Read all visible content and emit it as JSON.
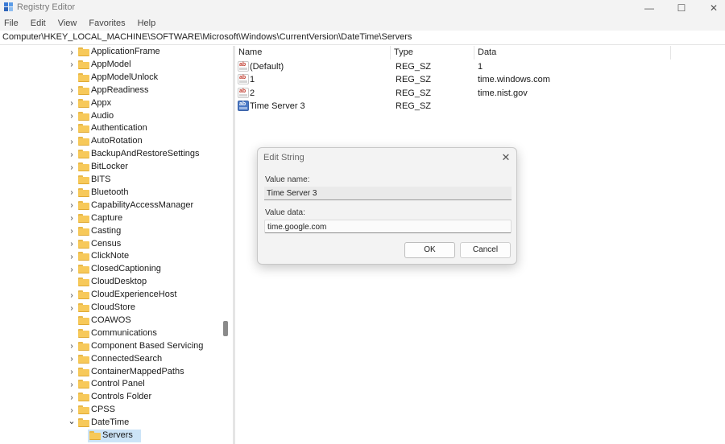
{
  "window": {
    "title": "Registry Editor",
    "minimize_glyph": "—",
    "maximize_glyph": "☐",
    "close_glyph": "✕"
  },
  "menu": [
    "File",
    "Edit",
    "View",
    "Favorites",
    "Help"
  ],
  "address": "Computer\\HKEY_LOCAL_MACHINE\\SOFTWARE\\Microsoft\\Windows\\CurrentVersion\\DateTime\\Servers",
  "tree": [
    {
      "label": "ApplicationFrame",
      "expandable": true
    },
    {
      "label": "AppModel",
      "expandable": true
    },
    {
      "label": "AppModelUnlock",
      "expandable": false
    },
    {
      "label": "AppReadiness",
      "expandable": true
    },
    {
      "label": "Appx",
      "expandable": true
    },
    {
      "label": "Audio",
      "expandable": true
    },
    {
      "label": "Authentication",
      "expandable": true
    },
    {
      "label": "AutoRotation",
      "expandable": true
    },
    {
      "label": "BackupAndRestoreSettings",
      "expandable": true
    },
    {
      "label": "BitLocker",
      "expandable": true
    },
    {
      "label": "BITS",
      "expandable": false
    },
    {
      "label": "Bluetooth",
      "expandable": true
    },
    {
      "label": "CapabilityAccessManager",
      "expandable": true
    },
    {
      "label": "Capture",
      "expandable": true
    },
    {
      "label": "Casting",
      "expandable": true
    },
    {
      "label": "Census",
      "expandable": true
    },
    {
      "label": "ClickNote",
      "expandable": true
    },
    {
      "label": "ClosedCaptioning",
      "expandable": true
    },
    {
      "label": "CloudDesktop",
      "expandable": false
    },
    {
      "label": "CloudExperienceHost",
      "expandable": true
    },
    {
      "label": "CloudStore",
      "expandable": true
    },
    {
      "label": "COAWOS",
      "expandable": false
    },
    {
      "label": "Communications",
      "expandable": false
    },
    {
      "label": "Component Based Servicing",
      "expandable": true
    },
    {
      "label": "ConnectedSearch",
      "expandable": true
    },
    {
      "label": "ContainerMappedPaths",
      "expandable": true
    },
    {
      "label": "Control Panel",
      "expandable": true
    },
    {
      "label": "Controls Folder",
      "expandable": true
    },
    {
      "label": "CPSS",
      "expandable": true
    },
    {
      "label": "DateTime",
      "expandable": true,
      "expanded": true
    },
    {
      "label": "Servers",
      "expandable": false,
      "child": true,
      "selected": true
    }
  ],
  "list": {
    "columns": [
      "Name",
      "Type",
      "Data"
    ],
    "rows": [
      {
        "name": "(Default)",
        "type": "REG_SZ",
        "data": "1",
        "icon": "string-value-icon"
      },
      {
        "name": "1",
        "type": "REG_SZ",
        "data": "time.windows.com",
        "icon": "string-value-icon"
      },
      {
        "name": "2",
        "type": "REG_SZ",
        "data": "time.nist.gov",
        "icon": "string-value-icon"
      },
      {
        "name": "Time Server 3",
        "type": "REG_SZ",
        "data": "",
        "icon": "string-value-icon",
        "selected": true
      }
    ]
  },
  "dialog": {
    "title": "Edit String",
    "close_glyph": "✕",
    "value_name_label": "Value name:",
    "value_name": "Time Server 3",
    "value_data_label": "Value data:",
    "value_data": "time.google.com",
    "ok_label": "OK",
    "cancel_label": "Cancel"
  },
  "icon_glyphs": {
    "string_value": "ab",
    "chevron_right": "›",
    "chevron_down": "⌄"
  },
  "colors": {
    "folder": "#f7c95a",
    "selection": "#cce4f7",
    "string_icon_red": "#c0392b",
    "selected_value_icon": "#4a78c4"
  }
}
